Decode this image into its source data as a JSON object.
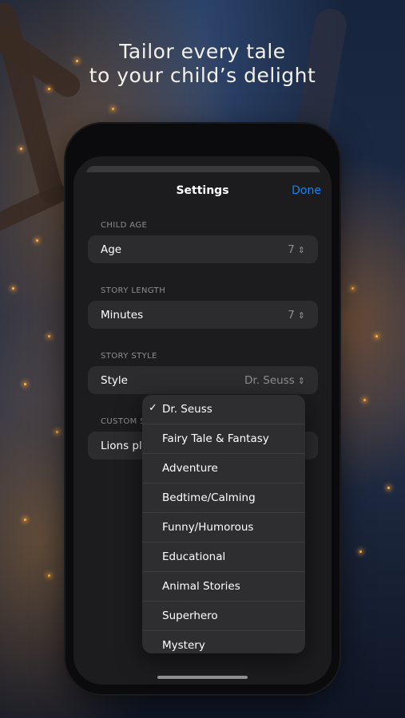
{
  "headline": {
    "line1": "Tailor every tale",
    "line2": "to your child’s delight"
  },
  "settings": {
    "title": "Settings",
    "done_label": "Done",
    "sections": {
      "age": {
        "header": "CHILD AGE",
        "label": "Age",
        "value": "7"
      },
      "length": {
        "header": "STORY LENGTH",
        "label": "Minutes",
        "value": "7"
      },
      "style": {
        "header": "STORY STYLE",
        "label": "Style",
        "value": "Dr. Seuss"
      },
      "custom": {
        "header": "CUSTOM S",
        "value": "Lions pla"
      }
    },
    "chevron_glyph": "⌃⌄"
  },
  "style_menu": {
    "selected": "Dr. Seuss",
    "check_glyph": "✓",
    "options": [
      "Dr. Seuss",
      "Fairy Tale & Fantasy",
      "Adventure",
      "Bedtime/Calming",
      "Funny/Humorous",
      "Educational",
      "Animal Stories",
      "Superhero",
      "Mystery"
    ]
  },
  "colors": {
    "accent": "#0a84ff",
    "background_sheet": "#1c1c1e",
    "row_fill": "#2c2c2e"
  }
}
